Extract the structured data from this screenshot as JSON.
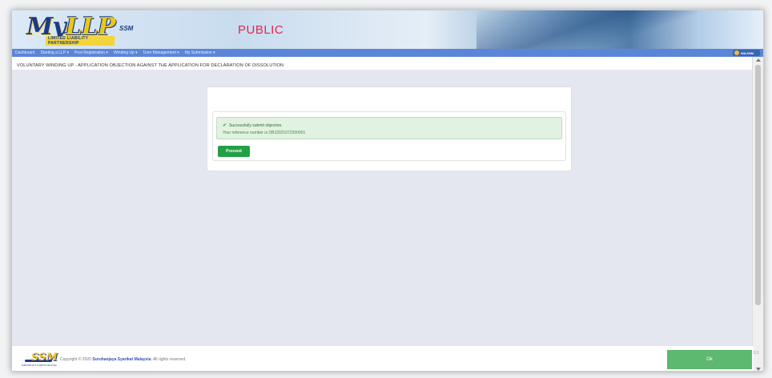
{
  "header": {
    "logo_my": "My",
    "logo_llp": "LLP",
    "logo_subtitle": "LIMITED LIABILITY PARTNERSHIP",
    "logo_ssm": "SSM",
    "environment": "PUBLIC"
  },
  "nav": {
    "items": [
      {
        "label": "Dashboard"
      },
      {
        "label": "Starting a LLP ▾"
      },
      {
        "label": "Post Registration ▾"
      },
      {
        "label": "Winding Up ▾"
      },
      {
        "label": "User Management ▾"
      },
      {
        "label": "My Submission ▾"
      }
    ],
    "user": "WILSSM"
  },
  "page": {
    "title": "VOLUNTARY WINDING UP - APPLICATION OBJECTION AGAINST THE APPLICATION FOR DECLARATION OF DISSOLUTION"
  },
  "alert": {
    "message": "Successfully submit objection.",
    "reference": "Your reference number is OBJ2021072300001"
  },
  "buttons": {
    "proceed": "Proceed",
    "ok": "Ok"
  },
  "footer": {
    "ssm_logo": "SSM",
    "ssm_small": "SURUHANJAYA SYARIKAT MALAYSIA",
    "copyright_prefix": "Copyright © 2020 ",
    "org": "Suruhanjaya Syarikat Malaysia",
    "copyright_suffix": ". All rights reserved.",
    "version": "0.1"
  },
  "colors": {
    "navbar": "#5b86d8",
    "environment": "#e0294a",
    "success": "#22a043",
    "ok_button": "#5cb96f"
  }
}
